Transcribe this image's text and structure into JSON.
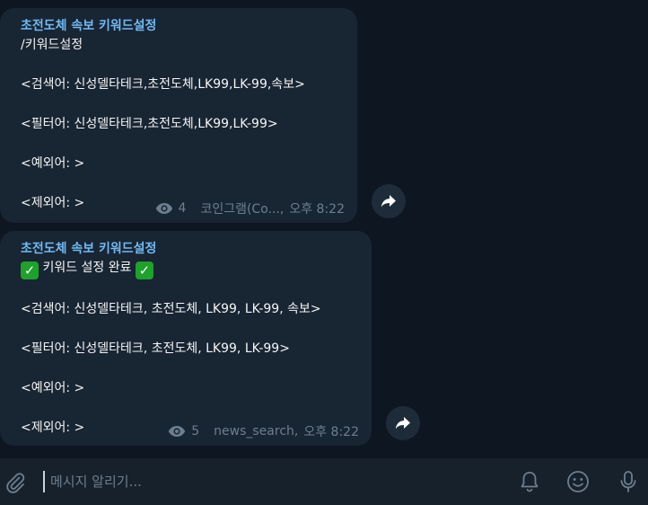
{
  "messages": [
    {
      "sender": "초전도체 속보 키워드설정",
      "lines": [
        "/키워드설정",
        "",
        "<검색어: 신성델타테크,초전도체,LK99,LK-99,속보>",
        "",
        "<필터어: 신성델타테크,초전도체,LK99,LK-99>",
        "",
        "<예외어: >",
        "",
        "<제외어: >"
      ],
      "views": "4",
      "author": "코인그램(Co...,",
      "time": "오후 8:22"
    },
    {
      "sender": "초전도체 속보 키워드설정",
      "status_text": "키워드 설정 완료",
      "lines": [
        "",
        "<검색어: 신성델타테크, 초전도체, LK99, LK-99, 속보>",
        "",
        "<필터어: 신성델타테크, 초전도체, LK99, LK-99>",
        "",
        "<예외어: >",
        "",
        "<제외어: >"
      ],
      "views": "5",
      "author": "news_search,",
      "time": "오후 8:22"
    }
  ],
  "composer": {
    "placeholder": "메시지 알리기..."
  },
  "colors": {
    "background": "#0e1621",
    "bubble": "#182533",
    "sender": "#71baf2",
    "meta": "#6d7f8f",
    "check": "#1fa12c"
  },
  "icons": [
    "eye-icon",
    "forward-icon",
    "check-icon",
    "paperclip-icon",
    "bell-icon",
    "emoji-icon",
    "microphone-icon"
  ]
}
